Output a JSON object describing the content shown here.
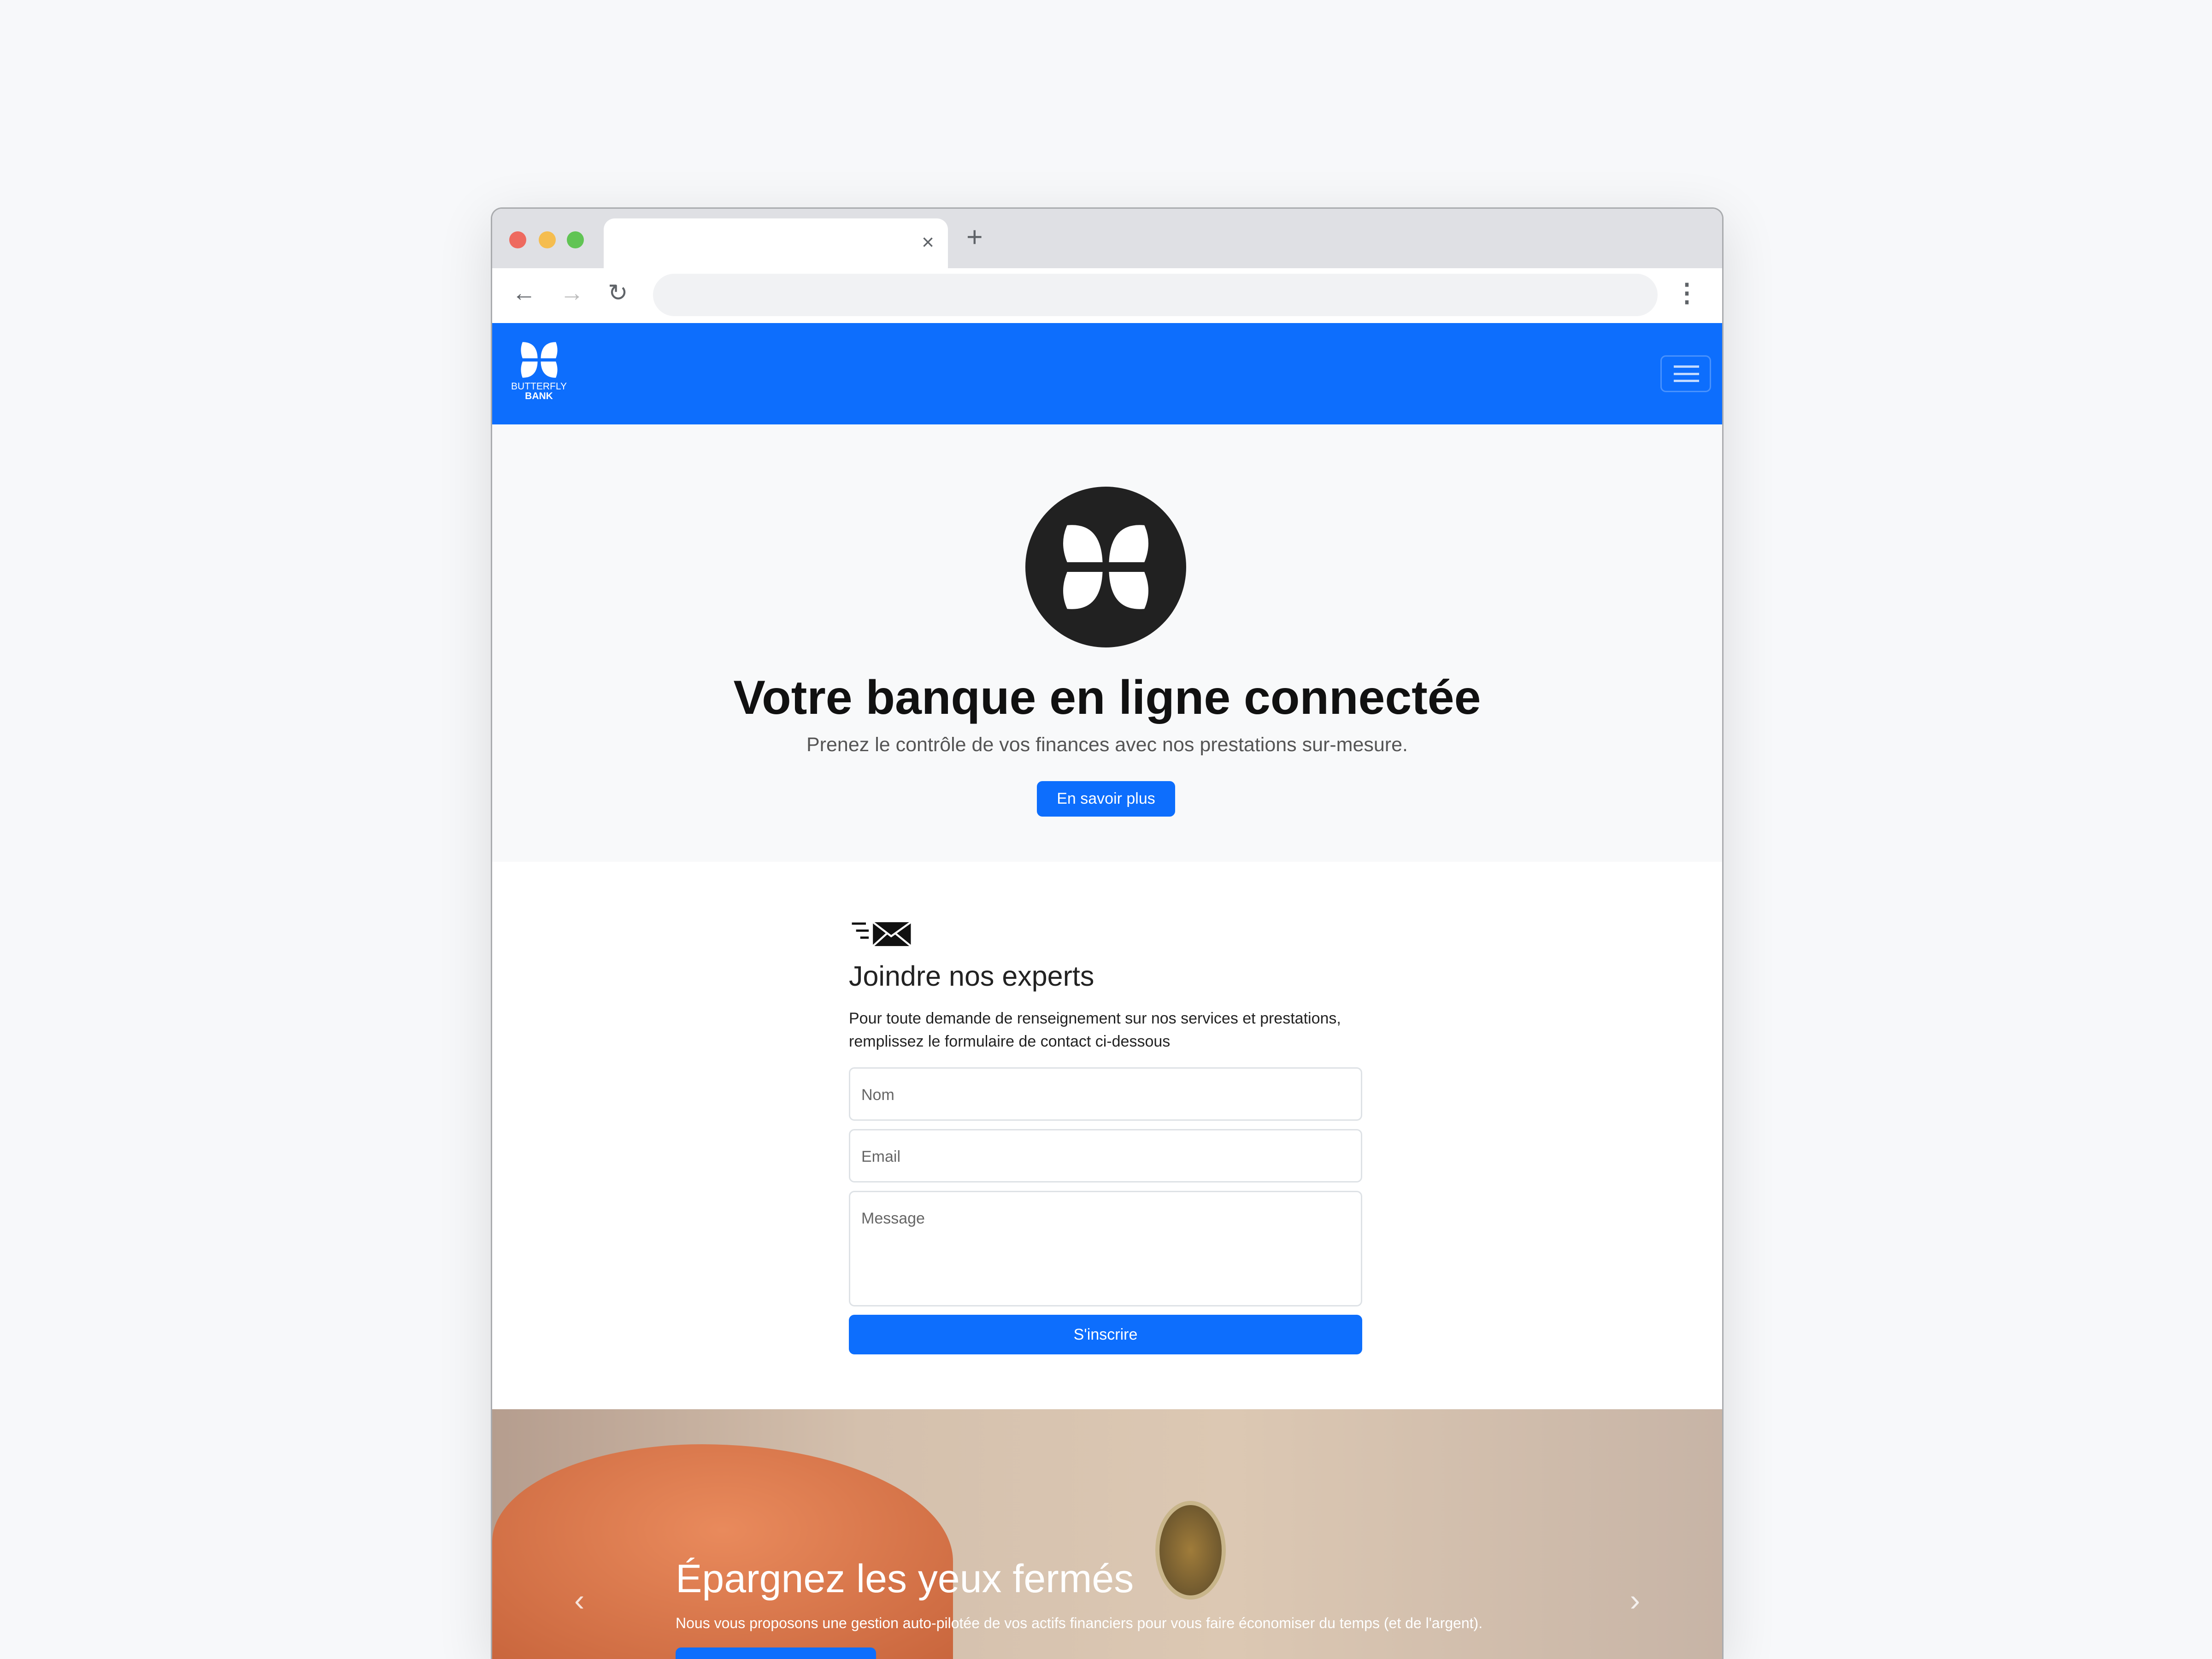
{
  "browser": {
    "tab_close": "×",
    "new_tab": "+",
    "back": "←",
    "forward": "→",
    "reload": "↻",
    "menu": "⋮",
    "colors": {
      "close": "#ee6a5f",
      "minimize": "#f5bd4f",
      "maximize": "#61c454"
    }
  },
  "navbar": {
    "brand_line1": "BUTTERFLY",
    "brand_line2": "BANK",
    "color": "#0d6efd"
  },
  "hero": {
    "title": "Votre banque en ligne connectée",
    "subtitle": "Prenez le contrôle de vos finances avec nos prestations sur-mesure.",
    "cta": "En savoir plus"
  },
  "contact": {
    "title": "Joindre nos experts",
    "description": "Pour toute demande de renseignement sur nos services et prestations, remplissez le formulaire de contact ci-dessous",
    "name_placeholder": "Nom",
    "email_placeholder": "Email",
    "message_placeholder": "Message",
    "submit": "S'inscrire"
  },
  "carousel": {
    "title": "Épargnez les yeux fermés",
    "text": "Nous vous proposons une gestion auto-pilotée de vos actifs financiers pour vous faire économiser du temps (et de l'argent).",
    "prev": "‹",
    "next": "›"
  }
}
